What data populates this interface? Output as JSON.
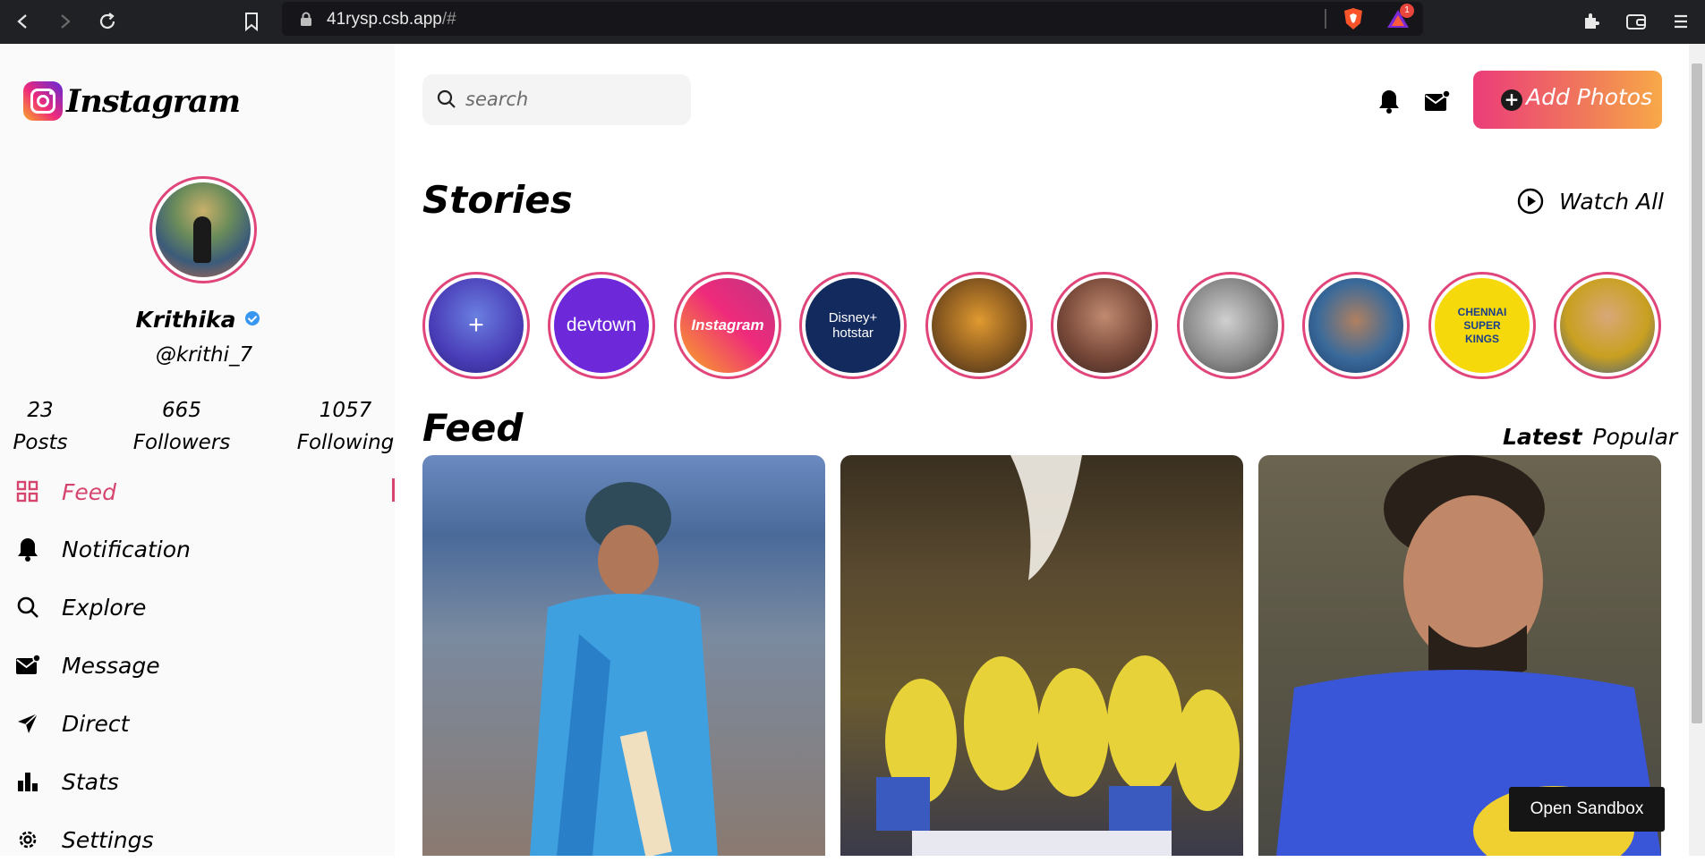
{
  "browser": {
    "url_domain": "41rysp.csb.app",
    "url_rest": "/#",
    "notification_count": "1"
  },
  "sidebar": {
    "logo_text": "Instagram",
    "profile": {
      "name": "Krithika",
      "handle": "@krithi_7"
    },
    "stats": [
      {
        "value": "23",
        "label": "Posts"
      },
      {
        "value": "665",
        "label": "Followers"
      },
      {
        "value": "1057",
        "label": "Following"
      }
    ],
    "menu": [
      {
        "label": "Feed",
        "icon": "grid-icon",
        "active": true
      },
      {
        "label": "Notification",
        "icon": "bell-icon"
      },
      {
        "label": "Explore",
        "icon": "search-icon"
      },
      {
        "label": "Message",
        "icon": "mail-icon"
      },
      {
        "label": "Direct",
        "icon": "send-icon"
      },
      {
        "label": "Stats",
        "icon": "bar-chart-icon"
      },
      {
        "label": "Settings",
        "icon": "gear-icon"
      }
    ]
  },
  "header": {
    "search_placeholder": "search",
    "add_photos_label": "Add Photos"
  },
  "stories": {
    "title": "Stories",
    "watch_all_label": "Watch All",
    "items": [
      {
        "label": "+"
      },
      {
        "label": "devtown"
      },
      {
        "label": "Instagram"
      },
      {
        "label": "Disney+ hotstar"
      },
      {
        "label": ""
      },
      {
        "label": ""
      },
      {
        "label": ""
      },
      {
        "label": ""
      },
      {
        "label": "CHENNAI SUPER KINGS"
      },
      {
        "label": ""
      }
    ]
  },
  "feed": {
    "title": "Feed",
    "tab_latest": "Latest",
    "tab_popular": "Popular"
  },
  "tooltip": "Open Sandbox",
  "colors": {
    "accent": "#d6456e",
    "story_ring": "#e0457b",
    "verified": "#3897f0"
  }
}
